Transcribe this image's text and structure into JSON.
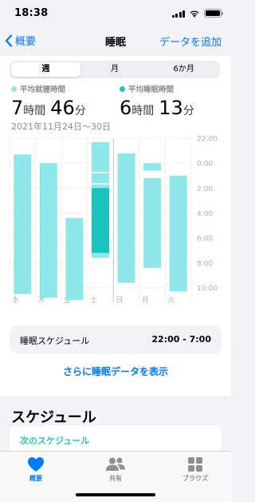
{
  "status_bar": {
    "time": "18:38"
  },
  "nav": {
    "back_label": "概要",
    "title": "睡眠",
    "right_action": "データを追加"
  },
  "segments": [
    {
      "label": "週",
      "active": true
    },
    {
      "label": "月",
      "active": false
    },
    {
      "label": "6か月",
      "active": false
    }
  ],
  "metrics": [
    {
      "label": "平均就寝時間",
      "color": "#8ee8ea",
      "hours": "7",
      "hours_unit": "時間",
      "minutes": "46",
      "minutes_unit": "分"
    },
    {
      "label": "平均睡眠時間",
      "color": "#19c4bf",
      "hours": "6",
      "hours_unit": "時間",
      "minutes": "13",
      "minutes_unit": "分"
    }
  ],
  "date_range": "2021年11月24日〜30日",
  "chart_data": {
    "type": "bar",
    "categories": [
      "水",
      "木",
      "金",
      "土",
      "日",
      "月",
      "火"
    ],
    "y_tick_labels": [
      "22:00",
      "0:00",
      "2:00",
      "4:00",
      "6:00",
      "8:00",
      "10:00"
    ],
    "ylim": [
      22,
      34
    ],
    "ylim_note": "hours after midnight of previous day; 24 = 0:00, 34 = 10:00",
    "colors": {
      "in_bed": "#8ee8ea",
      "asleep": "#19c4bf",
      "grid": "#e5e5ea"
    },
    "series": [
      {
        "values": [
          [
            [
              23.3,
              34.5
            ]
          ],
          [
            [
              24.0,
              34.8
            ]
          ],
          [
            [
              28.4,
              35.0
            ]
          ],
          [
            [
              22.3,
              31.6
            ]
          ],
          [
            [
              23.2,
              33.6
            ]
          ],
          [
            [
              24.0,
              24.6
            ],
            [
              25.2,
              32.4
            ]
          ],
          [
            [
              25.0,
              34.3
            ]
          ]
        ]
      },
      {
        "values": [
          [],
          [],
          [],
          [
            [
              26.0,
              31.2
            ]
          ],
          [],
          [],
          []
        ]
      }
    ]
  },
  "schedule": {
    "label": "睡眠スケジュール",
    "value": "22:00 - 7:00"
  },
  "more_link": "さらに睡眠データを表示",
  "section_title": "スケジュール",
  "next_schedule": "次のスケジュール",
  "tabs": [
    {
      "label": "概要",
      "icon": "heart-icon",
      "active": true
    },
    {
      "label": "共有",
      "icon": "people-icon",
      "active": false
    },
    {
      "label": "ブラウズ",
      "icon": "grid-icon",
      "active": false
    }
  ]
}
